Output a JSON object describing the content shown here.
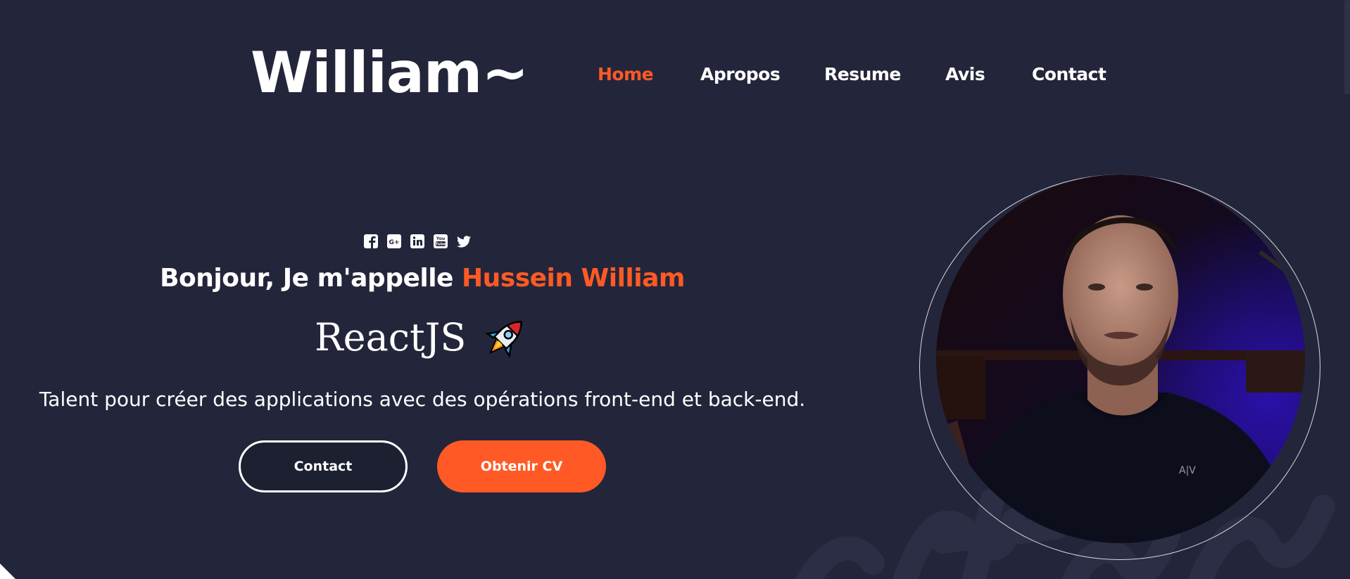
{
  "header": {
    "logo": "William~",
    "nav": [
      {
        "label": "Home",
        "active": true
      },
      {
        "label": "Apropos",
        "active": false
      },
      {
        "label": "Resume",
        "active": false
      },
      {
        "label": "Avis",
        "active": false
      },
      {
        "label": "Contact",
        "active": false
      }
    ]
  },
  "hero": {
    "social_icons": [
      "facebook-icon",
      "google-plus-icon",
      "linkedin-icon",
      "youtube-icon",
      "twitter-icon"
    ],
    "greeting_prefix": "Bonjour, Je m'appelle ",
    "greeting_name": "Hussein William",
    "role": "ReactJS",
    "role_icon": "rocket-icon",
    "tagline": "Talent pour créer des applications avec des opérations front-end et back-end.",
    "buttons": {
      "contact": "Contact",
      "cv": "Obtenir CV"
    }
  },
  "colors": {
    "background": "#23263a",
    "accent": "#ff5a25",
    "text": "#ffffff"
  }
}
